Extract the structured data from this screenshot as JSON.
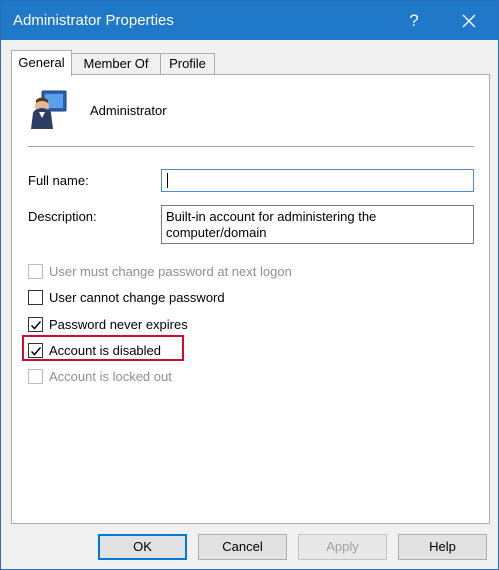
{
  "window": {
    "title": "Administrator Properties",
    "help_glyph": "?",
    "close_glyph": "✕",
    "accent_color": "#1f78c8"
  },
  "tabs": [
    {
      "label": "General",
      "active": true
    },
    {
      "label": "Member Of",
      "active": false
    },
    {
      "label": "Profile",
      "active": false
    }
  ],
  "general": {
    "user_name": "Administrator",
    "fields": {
      "full_name_label": "Full name:",
      "full_name_value": "",
      "description_label": "Description:",
      "description_value": "Built-in account for administering the computer/domain"
    },
    "checkboxes": [
      {
        "label": "User must change password at next logon",
        "checked": false,
        "enabled": false
      },
      {
        "label": "User cannot change password",
        "checked": false,
        "enabled": true
      },
      {
        "label": "Password never expires",
        "checked": true,
        "enabled": true
      },
      {
        "label": "Account is disabled",
        "checked": true,
        "enabled": true,
        "highlighted": true
      },
      {
        "label": "Account is locked out",
        "checked": false,
        "enabled": false
      }
    ],
    "highlight_color": "#c8102e"
  },
  "buttons": {
    "ok": "OK",
    "cancel": "Cancel",
    "apply": "Apply",
    "help": "Help"
  }
}
